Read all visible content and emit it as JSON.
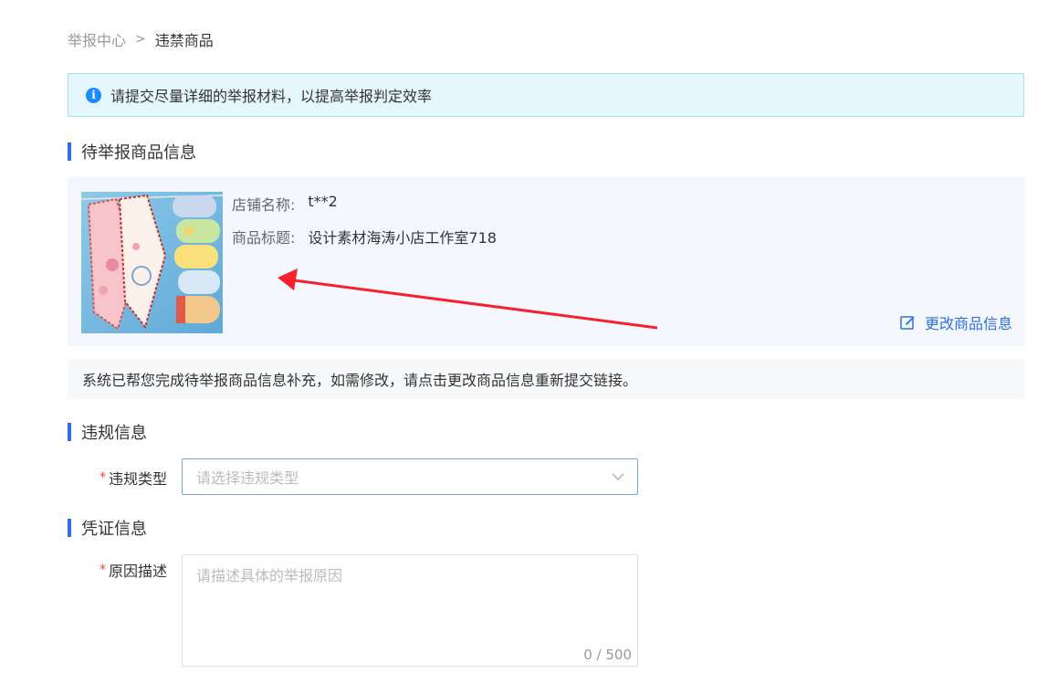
{
  "breadcrumb": {
    "parent": "举报中心",
    "separator": ">",
    "current": "违禁商品"
  },
  "alert": {
    "icon": "info-icon",
    "text": "请提交尽量详细的举报材料，以提高举报判定效率"
  },
  "sections": {
    "product": "待举报商品信息",
    "violation": "违规信息",
    "evidence": "凭证信息"
  },
  "product": {
    "shop_label": "店铺名称:",
    "shop_value": "t**2",
    "title_label": "商品标题:",
    "title_value": "设计素材海涛小店工作室718",
    "edit_label": "更改商品信息"
  },
  "notice": "系统已帮您完成待举报商品信息补充，如需修改，请点击更改商品信息重新提交链接。",
  "form": {
    "required_mark": "*",
    "violation_type_label": "违规类型",
    "violation_type_placeholder": "请选择违规类型",
    "reason_label": "原因描述",
    "reason_placeholder": "请描述具体的举报原因",
    "reason_counter": "0 / 500"
  },
  "colors": {
    "accent": "#2e6ee6",
    "alert_bg": "#e6f6fd",
    "required": "#f03e3e",
    "annotation": "#f5222d"
  }
}
